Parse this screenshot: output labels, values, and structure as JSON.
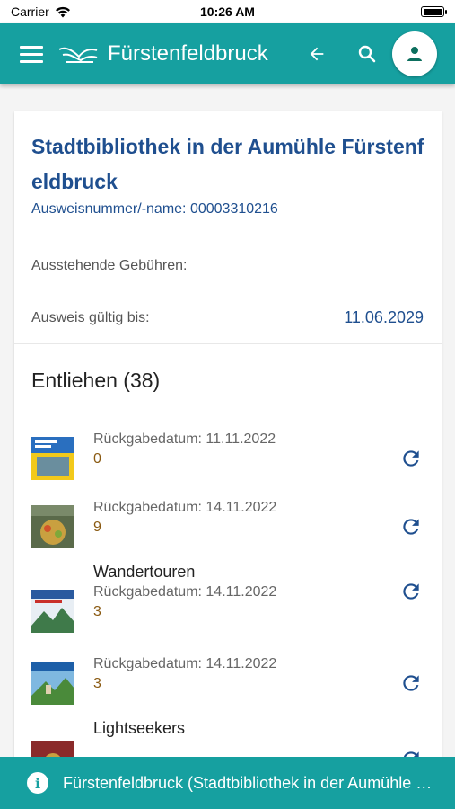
{
  "status_bar": {
    "carrier": "Carrier",
    "time": "10:26 AM"
  },
  "app_bar": {
    "title": "Fürstenfeldbruck",
    "icons": [
      "menu-icon",
      "logo",
      "back-arrow-icon",
      "search-icon",
      "person-icon"
    ]
  },
  "colors": {
    "primary": "#16a0a0",
    "accent_text": "#1f4f8f",
    "count_text": "#8a5a12"
  },
  "account": {
    "library_name": "Stadtbibliothek in der Aumühle Fürstenfeldbruck",
    "card_number": "Ausweisnummer/-name: 00003310216",
    "fees_label": "Ausstehende Gebühren:",
    "valid_label": "Ausweis gültig bis:",
    "valid_until": "11.06.2029"
  },
  "loans": {
    "heading": "Entliehen (38)",
    "items": [
      {
        "title": "",
        "date": "Rückgabedatum: 11.11.2022",
        "count": "0"
      },
      {
        "title": "",
        "date": "Rückgabedatum: 14.11.2022",
        "count": "9"
      },
      {
        "title": "Wandertouren",
        "date": "Rückgabedatum: 14.11.2022",
        "count": "3"
      },
      {
        "title": "",
        "date": "Rückgabedatum: 14.11.2022",
        "count": "3"
      },
      {
        "title": "Lightseekers",
        "date": "",
        "count": ""
      }
    ]
  },
  "snackbar": {
    "text": "Fürstenfeldbruck (Stadtbibliothek in der Aumühle Fürstenfeldbruck)"
  }
}
